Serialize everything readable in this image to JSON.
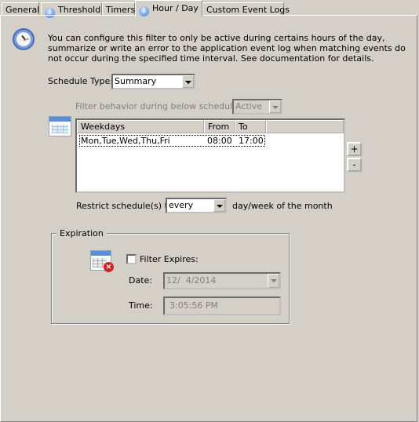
{
  "tabs": [
    {
      "label": "General"
    },
    {
      "label": "Threshold",
      "icon": "info-icon"
    },
    {
      "label": "Timers"
    },
    {
      "label": "Hour / Day",
      "icon": "info-icon",
      "active": true
    },
    {
      "label": "Custom Event Logs"
    }
  ],
  "description": "You can configure this filter to only be active during certains hours of the day, summarize or write an error to the application event log when matching events do not occur during the specified time interval. See documentation for details.",
  "schedule_type": {
    "label": "Schedule Type:",
    "value": "Summary"
  },
  "filter_behavior": {
    "label": "Filter behavior during below schedule(s):",
    "value": "Active"
  },
  "schedule_table": {
    "columns": [
      "Weekdays",
      "From",
      "To"
    ],
    "rows": [
      [
        "Mon,Tue,Wed,Thu,Fri",
        "08:00",
        "17:00"
      ]
    ]
  },
  "add_label": "+",
  "remove_label": "-",
  "restrict": {
    "label": "Restrict schedule(s) to",
    "value": "every",
    "suffix": "day/week of the month"
  },
  "expiration": {
    "title": "Expiration",
    "checkbox_label": "Filter Expires:",
    "checked": false,
    "date_label": "Date:",
    "date_value": "12/  4/2014",
    "time_label": "Time:",
    "time_value": "3:05:56 PM"
  }
}
